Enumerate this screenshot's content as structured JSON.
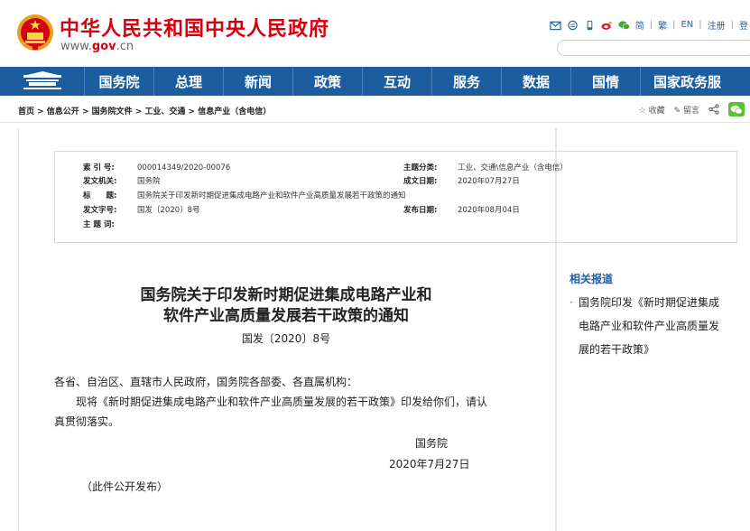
{
  "header": {
    "site_title": "中华人民共和国中央人民政府",
    "site_url_prefix": "www.",
    "site_url_gov": "gov",
    "site_url_suffix": ".cn",
    "tools": [
      "简",
      "繁",
      "EN",
      "注册",
      "登"
    ],
    "icons": [
      "mail-icon",
      "message-icon",
      "mobile-icon",
      "weibo-icon",
      "wechat-icon"
    ],
    "search_placeholder": ""
  },
  "nav": {
    "items": [
      "国务院",
      "总理",
      "新闻",
      "政策",
      "互动",
      "服务",
      "数据",
      "国情",
      "国家政务服"
    ]
  },
  "breadcrumb": {
    "text": "首页 > 信息公开 > 国务院文件 > 工业、交通 > 信息产业（含电信）",
    "favorite": "收藏",
    "comment": "留言"
  },
  "info": {
    "index_label": "索 引 号:",
    "index_value": "000014349/2020-00076",
    "category_label": "主题分类:",
    "category_value": "工业、交通\\信息产业（含电信）",
    "issuer_label": "发文机关:",
    "issuer_value": "国务院",
    "written_date_label": "成文日期:",
    "written_date_value": "2020年07月27日",
    "title_label": "标　　题:",
    "title_value": "国务院关于印发新时期促进集成电路产业和软件产业高质量发展若干政策的通知",
    "docno_label": "发文字号:",
    "docno_value": "国发〔2020〕8号",
    "publish_date_label": "发布日期:",
    "publish_date_value": "2020年08月04日",
    "keywords_label": "主 题 词:",
    "keywords_value": ""
  },
  "article": {
    "title_line1": "国务院关于印发新时期促进集成电路产业和",
    "title_line2": "软件产业高质量发展若干政策的通知",
    "doc_number": "国发〔2020〕8号",
    "salutation": "各省、自治区、直辖市人民政府，国务院各部委、各直属机构：",
    "body_line1": "现将《新时期促进集成电路产业和软件产业高质量发展的若干政策》印发给你们，请认",
    "body_line2": "真贯彻落实。",
    "signer": "国务院",
    "date": "2020年7月27日",
    "note": "（此件公开发布）"
  },
  "related": {
    "title": "相关报道",
    "items": [
      "国务院印发《新时期促进集成电路产业和软件产业高质量发展的若干政策》"
    ],
    "item_lines": [
      "国务院印发《新时期促进集成",
      "电路产业和软件产业高质量发",
      "展的若干政策》"
    ]
  },
  "colors": {
    "brand_red": "#d7000f",
    "nav_blue": "#1c5d9f",
    "link_blue": "#1d5fa3",
    "wechat_green": "#5fbf36"
  }
}
